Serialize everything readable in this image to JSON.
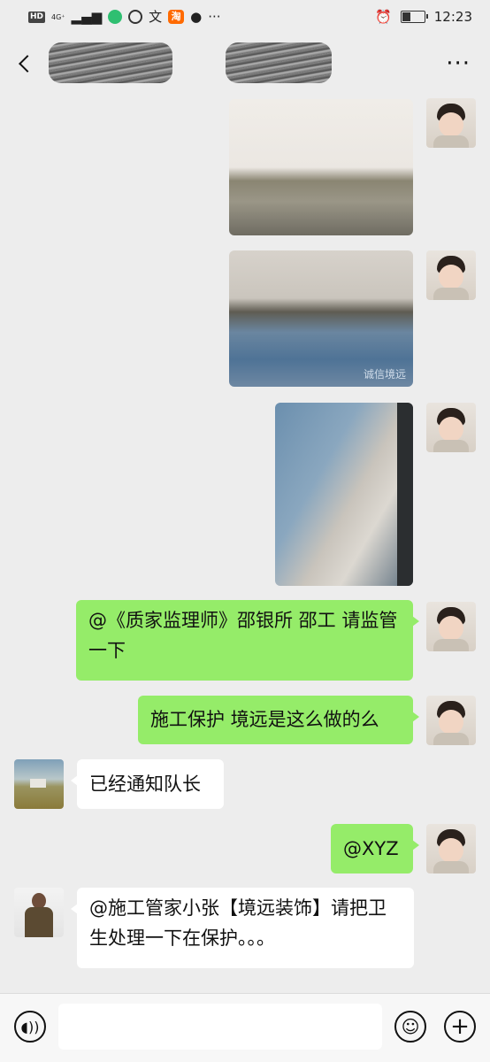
{
  "status_bar": {
    "hd": "HD",
    "network": "4G⁺",
    "time": "12:23",
    "battery_level": 0.35
  },
  "nav": {
    "title": "",
    "more": "···"
  },
  "messages": [
    {
      "sender": "me",
      "type": "image",
      "image_label": ""
    },
    {
      "sender": "me",
      "type": "image",
      "image_label": "诚信境远"
    },
    {
      "sender": "me",
      "type": "image",
      "image_label": ""
    },
    {
      "sender": "me",
      "type": "text",
      "text": "@《质家监理师》邵银所  邵工 请监管一下"
    },
    {
      "sender": "me",
      "type": "text",
      "text": "施工保护 境远是这么做的么"
    },
    {
      "sender": "other",
      "type": "text",
      "text": "已经通知队长"
    },
    {
      "sender": "me",
      "type": "text",
      "text": "@XYZ"
    },
    {
      "sender": "other",
      "type": "text",
      "text": "@施工管家小张【境远装饰】请把卫生处理一下在保护。。。"
    }
  ],
  "input_bar": {
    "placeholder": ""
  },
  "colors": {
    "bubble_me": "#95ec69",
    "bubble_other": "#ffffff",
    "background": "#ededed"
  }
}
